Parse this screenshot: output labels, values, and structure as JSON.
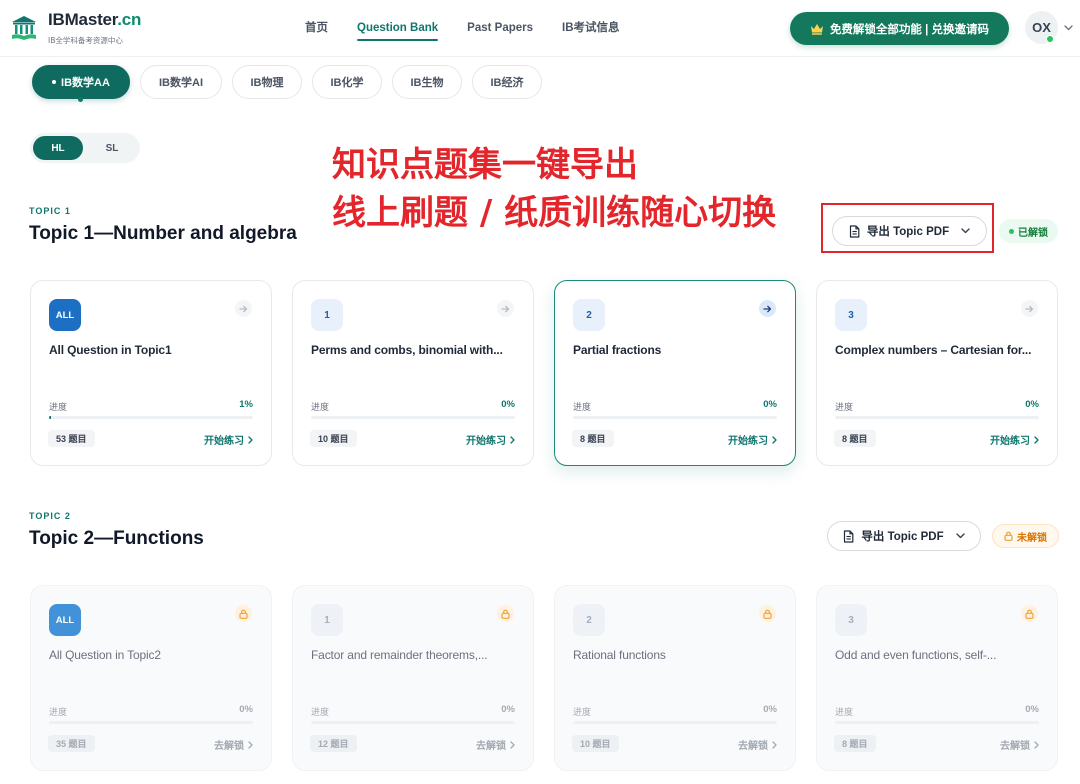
{
  "header": {
    "logo": {
      "icon": "academy-building-icon",
      "name": "IBMaster",
      "suffix": ".cn",
      "subtitle": "IB全学科备考资源中心"
    },
    "nav": [
      {
        "label": "首页",
        "active": false
      },
      {
        "label": "Question Bank",
        "active": true
      },
      {
        "label": "Past Papers",
        "active": false
      },
      {
        "label": "IB考试信息",
        "active": false
      }
    ],
    "cta": {
      "icon": "crown-icon",
      "label": "免费解锁全部功能 | 兑换邀请码"
    },
    "avatar": {
      "initials": "OX",
      "online": true,
      "icon": "chevron-down-icon"
    }
  },
  "subjects": [
    {
      "label": "IB数学AA",
      "active": true
    },
    {
      "label": "IB数学AI",
      "active": false
    },
    {
      "label": "IB物理",
      "active": false
    },
    {
      "label": "IB化学",
      "active": false
    },
    {
      "label": "IB生物",
      "active": false
    },
    {
      "label": "IB经济",
      "active": false
    }
  ],
  "level_toggle": [
    {
      "label": "HL",
      "active": true
    },
    {
      "label": "SL",
      "active": false
    }
  ],
  "promo_overlay": {
    "line1": "知识点题集一键导出",
    "line2": "线上刷题 / 纸质训练随心切换",
    "color": "#e3262c"
  },
  "topics": [
    {
      "kicker": "TOPIC 1",
      "title": "Topic 1—Number and algebra",
      "export_label": "导出 Topic PDF",
      "status": {
        "label": "已解锁",
        "locked": false
      },
      "cards": [
        {
          "badge": "ALL",
          "title": "All Question in Topic1",
          "progress_label": "进度",
          "progress": "1%",
          "count": "53 题目",
          "action": "开始练习",
          "selected": false
        },
        {
          "badge": "1",
          "title": "Perms and combs, binomial with...",
          "progress_label": "进度",
          "progress": "0%",
          "count": "10 题目",
          "action": "开始练习",
          "selected": false
        },
        {
          "badge": "2",
          "title": "Partial fractions",
          "progress_label": "进度",
          "progress": "0%",
          "count": "8 题目",
          "action": "开始练习",
          "selected": true
        },
        {
          "badge": "3",
          "title": "Complex numbers – Cartesian for...",
          "progress_label": "进度",
          "progress": "0%",
          "count": "8 题目",
          "action": "开始练习",
          "selected": false
        }
      ]
    },
    {
      "kicker": "TOPIC 2",
      "title": "Topic 2—Functions",
      "export_label": "导出 Topic PDF",
      "status": {
        "label": "未解锁",
        "locked": true
      },
      "cards": [
        {
          "badge": "ALL",
          "title": "All Question in Topic2",
          "progress_label": "进度",
          "progress": "0%",
          "count": "35 题目",
          "action": "去解锁",
          "locked": true
        },
        {
          "badge": "1",
          "title": "Factor and remainder theorems,...",
          "progress_label": "进度",
          "progress": "0%",
          "count": "12 题目",
          "action": "去解锁",
          "locked": true
        },
        {
          "badge": "2",
          "title": "Rational functions",
          "progress_label": "进度",
          "progress": "0%",
          "count": "10 题目",
          "action": "去解锁",
          "locked": true
        },
        {
          "badge": "3",
          "title": "Odd and even functions, self-...",
          "progress_label": "进度",
          "progress": "0%",
          "count": "8 题目",
          "action": "去解锁",
          "locked": true
        }
      ]
    }
  ],
  "colors": {
    "primary": "#0f6b5f",
    "accent_teal": "#0f766e",
    "cta_green": "#14785d",
    "badge_blue": "#1c6fc2",
    "unlocked_green": "#16803d",
    "locked_orange": "#d97706"
  }
}
